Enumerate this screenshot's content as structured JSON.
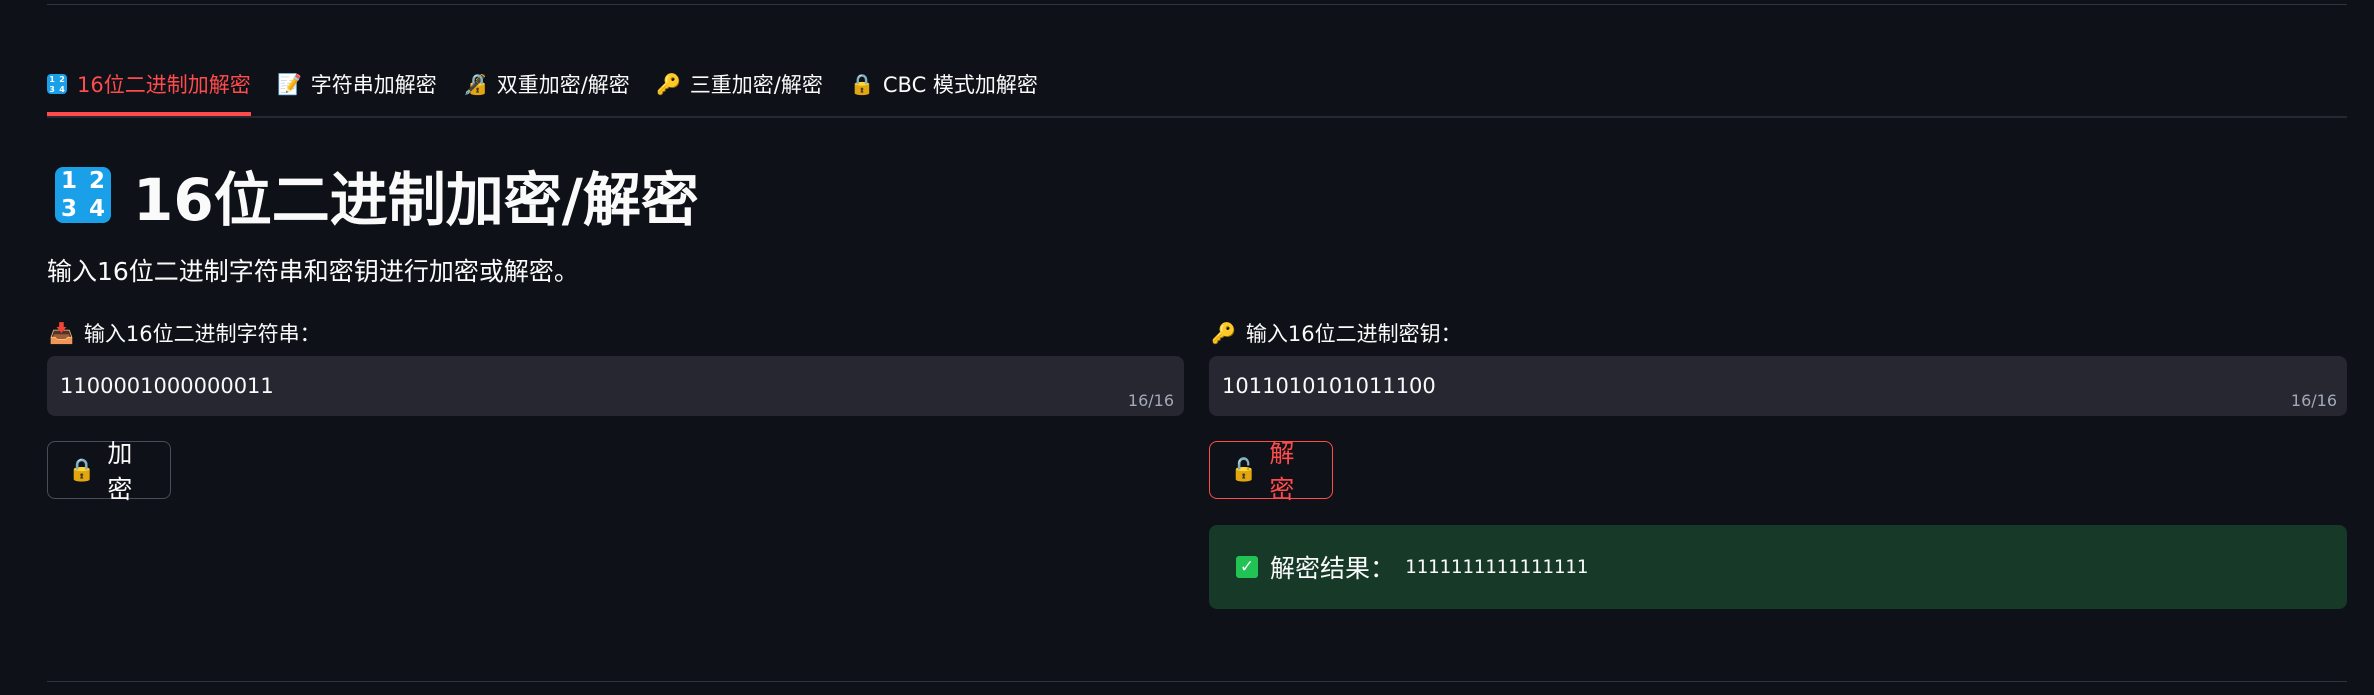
{
  "tabs": [
    {
      "label": "16位二进制加解密",
      "icon": "input-numbers-icon",
      "active": true
    },
    {
      "label": "字符串加解密",
      "icon": "memo-icon",
      "active": false
    },
    {
      "label": "双重加密/解密",
      "icon": "locked-with-pen-icon",
      "active": false
    },
    {
      "label": "三重加密/解密",
      "icon": "key-icon",
      "active": false
    },
    {
      "label": "CBC 模式加解密",
      "icon": "lock-icon",
      "active": false
    }
  ],
  "numbers_glyph": [
    "1",
    "2",
    "3",
    "4"
  ],
  "page": {
    "title": "16位二进制加密/解密",
    "subtitle": "输入16位二进制字符串和密钥进行加密或解密。"
  },
  "left": {
    "label": "输入16位二进制字符串：",
    "label_icon": "inbox-tray-icon",
    "value": "1100001000000011",
    "counter": "16/16",
    "button_label": "加密",
    "button_icon": "lock-icon"
  },
  "right": {
    "label": "输入16位二进制密钥：",
    "label_icon": "key-icon",
    "value": "1011010101011100",
    "counter": "16/16",
    "button_label": "解密",
    "button_icon": "unlocked-icon"
  },
  "result": {
    "label": "解密结果：",
    "value": "1111111111111111",
    "icon": "check-mark-button-icon"
  },
  "colors": {
    "accent": "#ff4b4b",
    "background": "#0e1117",
    "input_bg": "#262730",
    "success_bg": "#173928",
    "success_check": "#21c354"
  }
}
